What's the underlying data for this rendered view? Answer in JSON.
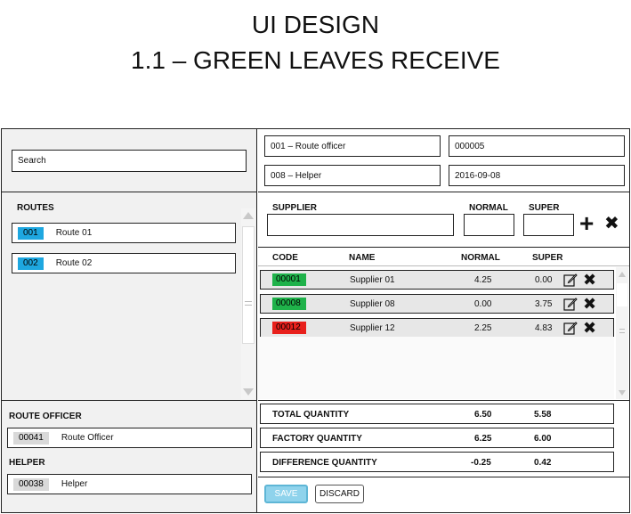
{
  "page_title": "UI DESIGN",
  "page_subtitle": "1.1 – GREEN LEAVES RECEIVE",
  "search": {
    "placeholder": "Search"
  },
  "header_fields": {
    "route_officer": "001 – Route officer",
    "helper": "008 – Helper",
    "number": "000005",
    "date": "2016-09-08"
  },
  "routes": {
    "heading": "ROUTES",
    "items": [
      {
        "code": "001",
        "name": "Route 01"
      },
      {
        "code": "002",
        "name": "Route 02"
      }
    ]
  },
  "route_officer": {
    "heading": "ROUTE OFFICER",
    "code": "00041",
    "name": "Route Officer"
  },
  "helper": {
    "heading": "HELPER",
    "code": "00038",
    "name": "Helper"
  },
  "entry": {
    "supplier_label": "SUPPLIER",
    "normal_label": "NORMAL",
    "super_label": "SUPER",
    "add_symbol": "+",
    "clear_symbol": "✖"
  },
  "table": {
    "headers": {
      "code": "CODE",
      "name": "NAME",
      "normal": "NORMAL",
      "super": "SUPER"
    },
    "rows": [
      {
        "code": "00001",
        "name": "Supplier 01",
        "normal": "4.25",
        "super": "0.00",
        "status_color": "#1fb24a"
      },
      {
        "code": "00008",
        "name": "Supplier 08",
        "normal": "0.00",
        "super": "3.75",
        "status_color": "#1fb24a"
      },
      {
        "code": "00012",
        "name": "Supplier 12",
        "normal": "2.25",
        "super": "4.83",
        "status_color": "#e8201c"
      }
    ]
  },
  "totals": [
    {
      "label": "TOTAL QUANTITY",
      "normal": "6.50",
      "super": "5.58"
    },
    {
      "label": "FACTORY  QUANTITY",
      "normal": "6.25",
      "super": "6.00"
    },
    {
      "label": "DIFFERENCE QUANTITY",
      "normal": "-0.25",
      "super": "0.42"
    }
  ],
  "buttons": {
    "save": "SAVE",
    "discard": "DISCARD"
  },
  "colors": {
    "route_code": "#1ea7e0",
    "save_button": "#8fd3ec",
    "code_grey": "#d9d9d9"
  }
}
